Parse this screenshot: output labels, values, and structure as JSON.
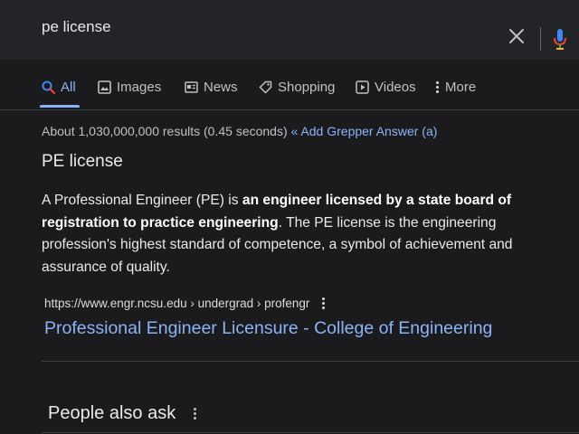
{
  "search": {
    "query": "pe license"
  },
  "tabs": [
    {
      "label": "All",
      "icon": "search-icon",
      "active": true
    },
    {
      "label": "Images",
      "icon": "image-icon"
    },
    {
      "label": "News",
      "icon": "news-icon"
    },
    {
      "label": "Shopping",
      "icon": "tag-icon"
    },
    {
      "label": "Videos",
      "icon": "play-icon"
    },
    {
      "label": "More",
      "icon": "more-vert-icon"
    }
  ],
  "stats": {
    "text": "About 1,030,000,000 results (0.45 seconds)",
    "grepper": "« Add Grepper Answer (a)"
  },
  "snippet": {
    "title": "PE license",
    "part1": "A Professional Engineer (PE) is ",
    "bold": "an engineer licensed by a state board of registration to practice engineering",
    "part2": ". The PE license is the engineering profession's highest standard of competence, a symbol of achievement and assurance of quality."
  },
  "result": {
    "url": "https://www.engr.ncsu.edu › undergrad › profengr",
    "title": "Professional Engineer Licensure - College of Engineering"
  },
  "people_also_ask": {
    "label": "People also ask"
  },
  "colors": {
    "background": "#1b1b1d",
    "link": "#8ab4f8",
    "text": "#e8eaed"
  }
}
